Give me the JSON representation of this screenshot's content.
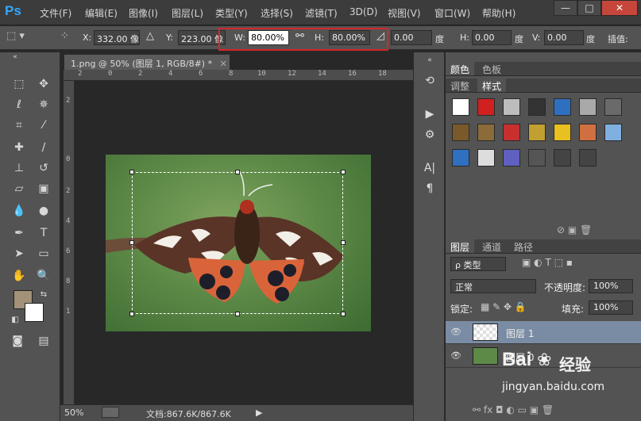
{
  "app": {
    "logo": "Ps"
  },
  "menu": [
    "文件(F)",
    "编辑(E)",
    "图像(I)",
    "图层(L)",
    "类型(Y)",
    "选择(S)",
    "滤镜(T)",
    "3D(D)",
    "视图(V)",
    "窗口(W)",
    "帮助(H)"
  ],
  "window_controls": {
    "minimize": "—",
    "restore": "□",
    "close": "✕"
  },
  "options": {
    "x_label": "X:",
    "x_value": "332.00 像",
    "y_label": "Y:",
    "y_value": "223.00 像",
    "w_label": "W:",
    "w_value": "80.00%",
    "h_label": "H:",
    "h_value": "80.00%",
    "angle_value": "0.00",
    "angle_unit": "度",
    "hskew_label": "H:",
    "hskew_value": "0.00",
    "hskew_unit": "度",
    "vskew_label": "V:",
    "vskew_value": "0.00",
    "vskew_unit": "度",
    "interp_label": "插值:"
  },
  "document": {
    "tab_title": "1.png @ 50% (图层 1, RGB/8#) *",
    "ruler_top": [
      "2",
      "0",
      "2",
      "4",
      "6",
      "8",
      "10",
      "12",
      "14",
      "16",
      "18"
    ],
    "ruler_left": [
      "2",
      "0",
      "2",
      "4",
      "6",
      "8",
      "1"
    ],
    "zoom": "50%",
    "doc_info": "文档:867.6K/867.6K"
  },
  "panels": {
    "top_tabs": [
      "颜色",
      "色板"
    ],
    "second_tabs": [
      "调整",
      "样式"
    ],
    "style_colors": [
      "#ffffff",
      "#d02020",
      "#bdbdbd",
      "#333333",
      "#2f6fc0",
      "#a9a9a9",
      "#6a6a6a",
      "#7a5a2a",
      "#8b6b3a",
      "#c83030",
      "#c0a030",
      "#e8c020",
      "#d07040",
      "#80b0e0",
      "#3070c0",
      "#dddddd",
      "#6060c0",
      "#555555",
      "#444444",
      "#444444"
    ],
    "layers_tabs": [
      "图层",
      "通道",
      "路径"
    ],
    "filter_kind": "ρ 类型",
    "blend_mode": "正常",
    "opacity_label": "不透明度:",
    "opacity_value": "100%",
    "lock_label": "锁定:",
    "fill_label": "填充:",
    "fill_value": "100%",
    "layers": [
      {
        "name": "图层 1",
        "selected": true
      },
      {
        "name": "图层 0",
        "selected": false
      }
    ]
  },
  "watermark": {
    "brand": "Bai",
    "brand2": "经验",
    "url": "jingyan.baidu.com"
  }
}
